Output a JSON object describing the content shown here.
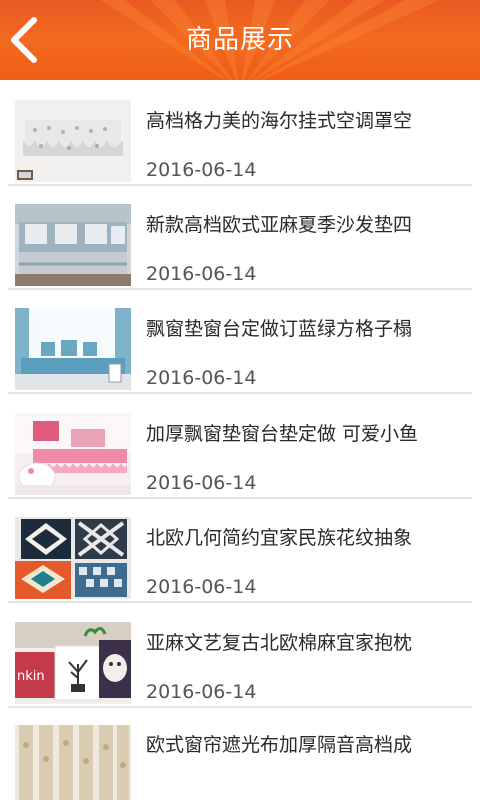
{
  "header": {
    "title": "商品展示",
    "back_icon": "chevron-left-icon"
  },
  "products": [
    {
      "name": "高档格力美的海尔挂式空调罩空",
      "date": "2016-06-14"
    },
    {
      "name": "新款高档欧式亚麻夏季沙发垫四",
      "date": "2016-06-14"
    },
    {
      "name": "飘窗垫窗台定做订蓝绿方格子榻",
      "date": "2016-06-14"
    },
    {
      "name": "加厚飘窗垫窗台垫定做 可爱小鱼",
      "date": "2016-06-14"
    },
    {
      "name": "北欧几何简约宜家民族花纹抽象",
      "date": "2016-06-14"
    },
    {
      "name": "亚麻文艺复古北欧棉麻宜家抱枕",
      "date": "2016-06-14"
    },
    {
      "name": "欧式窗帘遮光布加厚隔音高档成",
      "date": ""
    }
  ],
  "thumb_texts": {
    "item6_tag": "nkin"
  },
  "colors": {
    "header": "#ef5d18",
    "divider": "#e4e4e4"
  }
}
